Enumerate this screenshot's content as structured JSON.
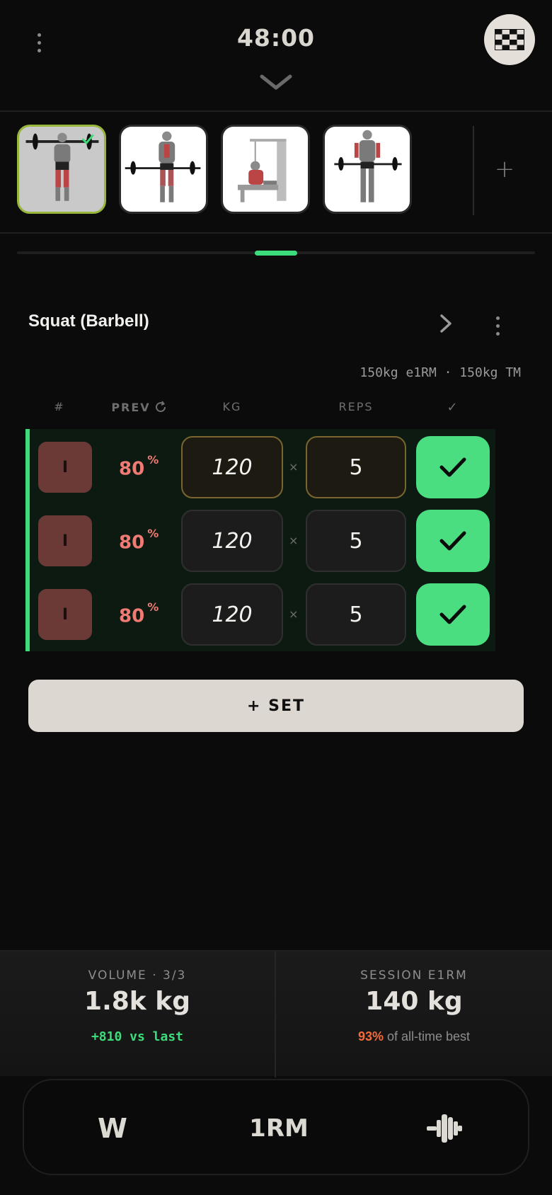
{
  "header": {
    "timer": "48:00"
  },
  "exercise": {
    "name": "Squat (Barbell)",
    "rm_info": "150kg e1RM · 150kg TM"
  },
  "columns": {
    "num": "#",
    "prev": "PREV",
    "kg": "KG",
    "reps": "REPS",
    "done": "✓"
  },
  "sets": [
    {
      "badge": "I",
      "prev": "80",
      "prev_unit": "%",
      "kg": "120",
      "reps": "5",
      "completed": true
    },
    {
      "badge": "I",
      "prev": "80",
      "prev_unit": "%",
      "kg": "120",
      "reps": "5",
      "completed": true
    },
    {
      "badge": "I",
      "prev": "80",
      "prev_unit": "%",
      "kg": "120",
      "reps": "5",
      "completed": true
    }
  ],
  "times_sign": "×",
  "add_set_label": "+ SET",
  "stats": {
    "volume": {
      "label": "VOLUME · 3/3",
      "value": "1.8k kg",
      "delta": "+810 vs last"
    },
    "e1rm": {
      "label": "SESSION E1RM",
      "value": "140 kg",
      "pct": "93%",
      "pct_suffix": " of all-time best"
    }
  },
  "bottom_bar": {
    "w_label": "W",
    "rm_label": "1RM"
  },
  "add_exercise": "+",
  "colors": {
    "accent_green": "#4ade80",
    "prev_red": "#f07b74",
    "highlight_gold": "#7a6530",
    "active_thumb_border": "#98b53c"
  },
  "icons": [
    "more-vertical-icon",
    "chevron-down-icon",
    "checkered-flag-icon",
    "chevron-right-icon",
    "refresh-icon",
    "check-icon",
    "plate-loader-icon"
  ]
}
